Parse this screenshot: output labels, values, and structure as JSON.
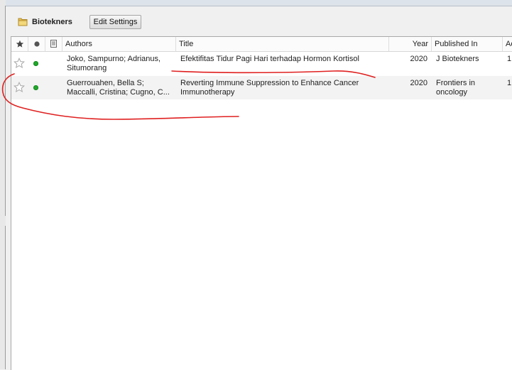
{
  "library": {
    "title": "Biotekners",
    "edit_button": "Edit Settings"
  },
  "icons": {
    "folder": "folder-icon",
    "star": "star-icon",
    "read_status": "dot-icon",
    "attachment": "document-icon"
  },
  "columns": {
    "authors": "Authors",
    "title": "Title",
    "year": "Year",
    "published_in": "Published In",
    "added": "Ac"
  },
  "rows": [
    {
      "authors": "Joko, Sampurno; Adrianus, Situmorang",
      "title": "Efektifitas Tidur Pagi Hari terhadap Hormon Kortisol",
      "year": "2020",
      "published_in": "J Biotekners",
      "added": "1"
    },
    {
      "authors": "Guerrouahen, Bella S; Maccalli, Cristina; Cugno, C...",
      "title": "Reverting Immune Suppression to Enhance Cancer Immunotherapy",
      "year": "2020",
      "published_in": "Frontiers in oncology",
      "added": "1"
    }
  ],
  "colors": {
    "read_dot": "#22a82c",
    "annotation": "#e02020"
  }
}
